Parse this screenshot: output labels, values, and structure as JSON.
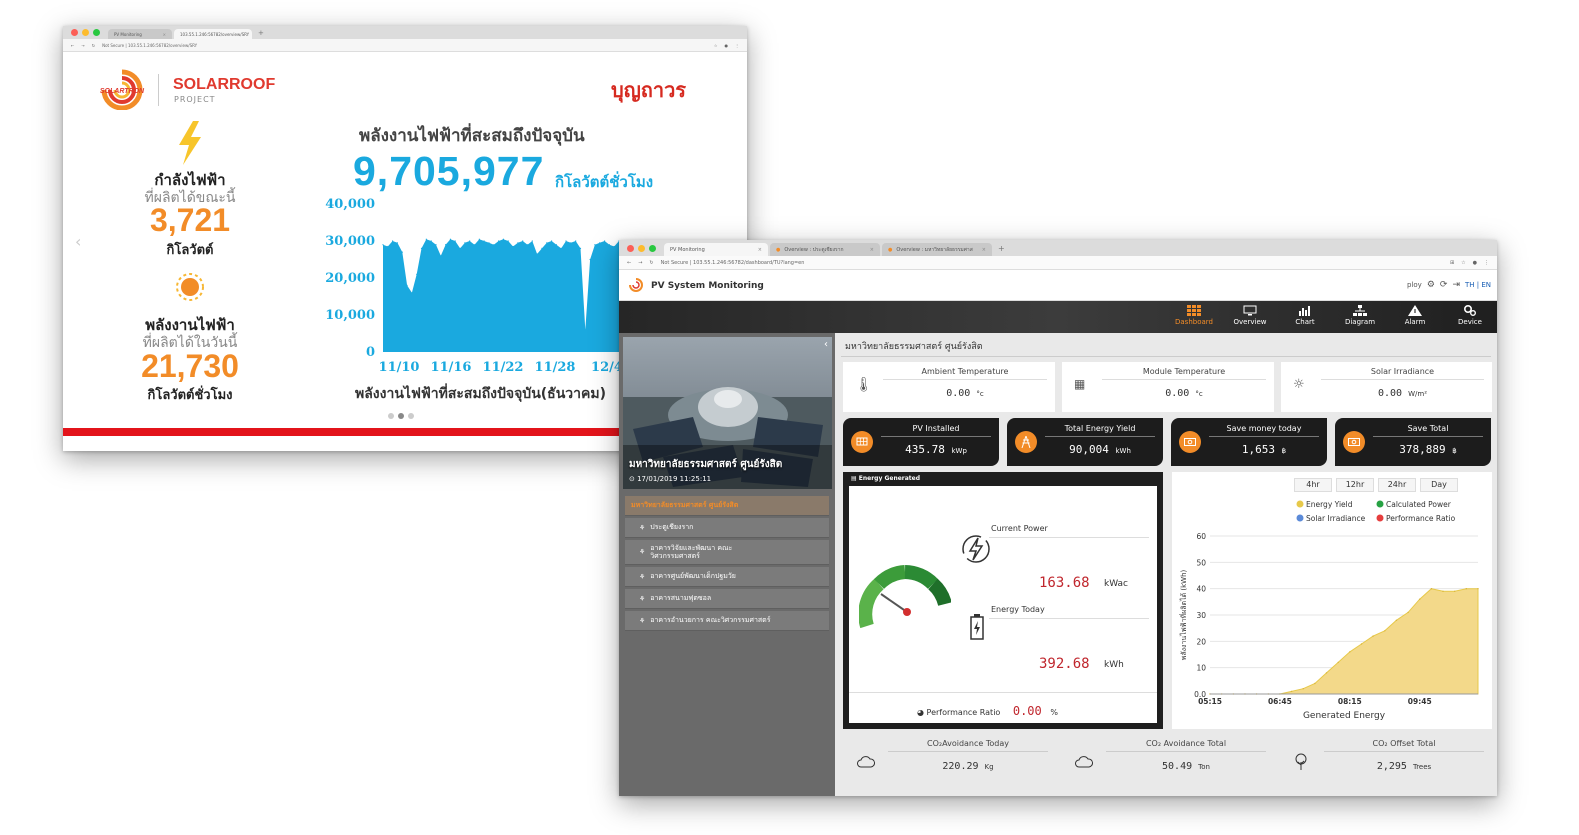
{
  "win1": {
    "tabs": [
      {
        "label": "PV Monitoring"
      },
      {
        "label": "103.55.1.246:56782/overview/SRY"
      }
    ],
    "url": "Not Secure  |  103.55.1.246:56782/overview/SRY",
    "brand_logo_text": "SOLARTRON",
    "project_title": "SOLARROOF",
    "project_sub": "PROJECT",
    "partner_logo": "บุญถาวร",
    "power": {
      "label": "กำลังไฟฟ้า",
      "sub": "ที่ผลิตได้ขณะนี้",
      "value": "3,721",
      "unit": "กิโลวัตต์"
    },
    "energy": {
      "label": "พลังงานไฟฟ้า",
      "sub": "ที่ผลิตได้ในวันนี้",
      "value": "21,730",
      "unit": "กิโลวัตต์ชั่วโมง"
    },
    "accum_title": "พลังงานไฟฟ้าที่สะสมถึงปัจจุบัน",
    "accum_value": "9,705,977",
    "accum_unit": "กิโลวัตต์ชั่วโมง",
    "accum_caption": "พลังงานไฟฟ้าที่สะสมถึงปัจจุบัน(ธันวาคม)"
  },
  "win2": {
    "tabs": [
      {
        "label": "PV Monitoring"
      },
      {
        "label": "Overview : ประตูเชียงราก"
      },
      {
        "label": "Overview : มหาวิทยาลัยธรรมศาส"
      }
    ],
    "url": "Not Secure  |  103.55.1.246:56782/dashboard/TU?lang=en",
    "app_title": "PV System Monitoring",
    "user": "ploy",
    "lang": "TH | EN",
    "nav": [
      {
        "label": "Dashboard",
        "icon": "grid-icon"
      },
      {
        "label": "Overview",
        "icon": "monitor-icon"
      },
      {
        "label": "Chart",
        "icon": "bar-chart-icon"
      },
      {
        "label": "Diagram",
        "icon": "hierarchy-icon"
      },
      {
        "label": "Alarm",
        "icon": "warning-icon"
      },
      {
        "label": "Device",
        "icon": "gears-icon"
      }
    ],
    "site_name": "มหาวิทยาลัยธรรมศาสตร์ ศูนย์รังสิต",
    "site_date": "17/01/2019 11:25:11",
    "menu": [
      {
        "label": "มหาวิทยาลัยธรรมศาสตร์ ศูนย์รังสิต"
      },
      {
        "label": "ประตูเชียงราก"
      },
      {
        "label": "อาคารวิจัยและพัฒนา คณะ วิศวกรรมศาสตร์"
      },
      {
        "label": "อาคารศูนย์พัฒนาเด็กปฐมวัย"
      },
      {
        "label": "อาคารสนามฟุตซอล"
      },
      {
        "label": "อาคารอำนวยการ คณะวิศวกรรมศาสตร์"
      }
    ],
    "main_title": "มหาวิทยาลัยธรรมศาสตร์ ศูนย์รังสิต",
    "weather": [
      {
        "title": "Ambient Temperature",
        "value": "0.00",
        "unit": "°c"
      },
      {
        "title": "Module Temperature",
        "value": "0.00",
        "unit": "°c"
      },
      {
        "title": "Solar Irradiance",
        "value": "0.00",
        "unit": "W/m²"
      }
    ],
    "kpis": [
      {
        "title": "PV Installed",
        "value": "435.78",
        "unit": "kWp"
      },
      {
        "title": "Total Energy Yield",
        "value": "90,004",
        "unit": "kWh"
      },
      {
        "title": "Save money today",
        "value": "1,653",
        "unit": "฿"
      },
      {
        "title": "Save Total",
        "value": "378,889",
        "unit": "฿"
      }
    ],
    "energy_panel": {
      "header": "Energy Generated",
      "current_label": "Current Power",
      "current_value": "163.68",
      "current_unit": "kWac",
      "today_label": "Energy Today",
      "today_value": "392.68",
      "today_unit": "kWh",
      "pr_label": "Performance Ratio",
      "pr_value": "0.00",
      "pr_unit": "%"
    },
    "range_buttons": [
      "4hr",
      "12hr",
      "24hr",
      "Day"
    ],
    "bottom": [
      {
        "title": "CO₂Avoidance Today",
        "value": "220.29",
        "unit": "Kg"
      },
      {
        "title": "CO₂ Avoidance Total",
        "value": "50.49",
        "unit": "Ton"
      },
      {
        "title": "CO₂ Offset Total",
        "value": "2,295",
        "unit": "Trees"
      }
    ]
  },
  "chart_data": [
    {
      "type": "area",
      "title": "",
      "xlabel": "",
      "ylabel": "",
      "x_ticks": [
        "11/10",
        "11/16",
        "11/22",
        "11/28",
        "12/4"
      ],
      "y_ticks": [
        "0",
        "10,000",
        "20,000",
        "30,000",
        "40,000"
      ],
      "ylim": [
        0,
        40000
      ],
      "color": "#1aa9df",
      "values": [
        29000,
        28500,
        30000,
        29500,
        27000,
        18000,
        16000,
        21000,
        28000,
        30500,
        30000,
        29000,
        26000,
        29000,
        30500,
        30000,
        28000,
        29500,
        30000,
        29000,
        30500,
        30000,
        29500,
        29000,
        30000,
        30500,
        30000,
        28500,
        29500,
        30000,
        29000,
        30000,
        26500,
        28000,
        29500,
        30000,
        29000,
        28000,
        30000,
        29500,
        30000,
        28000,
        6000,
        25000,
        29000,
        29500,
        30000,
        29000,
        28500,
        30000
      ]
    },
    {
      "type": "area",
      "title": "",
      "xlabel": "Generated Energy",
      "ylabel": "พลังงานไฟฟ้าที่ผลิตได้ (kWh)",
      "x_ticks": [
        "05:15",
        "06:45",
        "08:15",
        "09:45"
      ],
      "y_ticks": [
        "0.0",
        "10",
        "20",
        "30",
        "40",
        "50",
        "60"
      ],
      "ylim": [
        0,
        60
      ],
      "legend": [
        "Energy Yield",
        "Calculated Power",
        "Solar Irradiance",
        "Performance Ratio"
      ],
      "legend_colors": [
        "#e7c94a",
        "#27a243",
        "#5b8ad8",
        "#e63e3e"
      ],
      "color": "#f3d98a",
      "x": [
        "05:15",
        "05:30",
        "05:45",
        "06:00",
        "06:15",
        "06:30",
        "06:45",
        "07:00",
        "07:15",
        "07:30",
        "07:45",
        "08:00",
        "08:15",
        "08:30",
        "08:45",
        "09:00",
        "09:15",
        "09:30",
        "09:45",
        "10:00",
        "10:15",
        "10:30",
        "10:45",
        "11:00"
      ],
      "values": [
        0,
        0,
        0,
        0,
        0,
        0,
        0,
        1,
        2,
        4,
        8,
        12,
        16,
        19,
        22,
        24,
        28,
        31,
        36,
        40,
        39,
        39,
        40,
        40
      ]
    }
  ]
}
